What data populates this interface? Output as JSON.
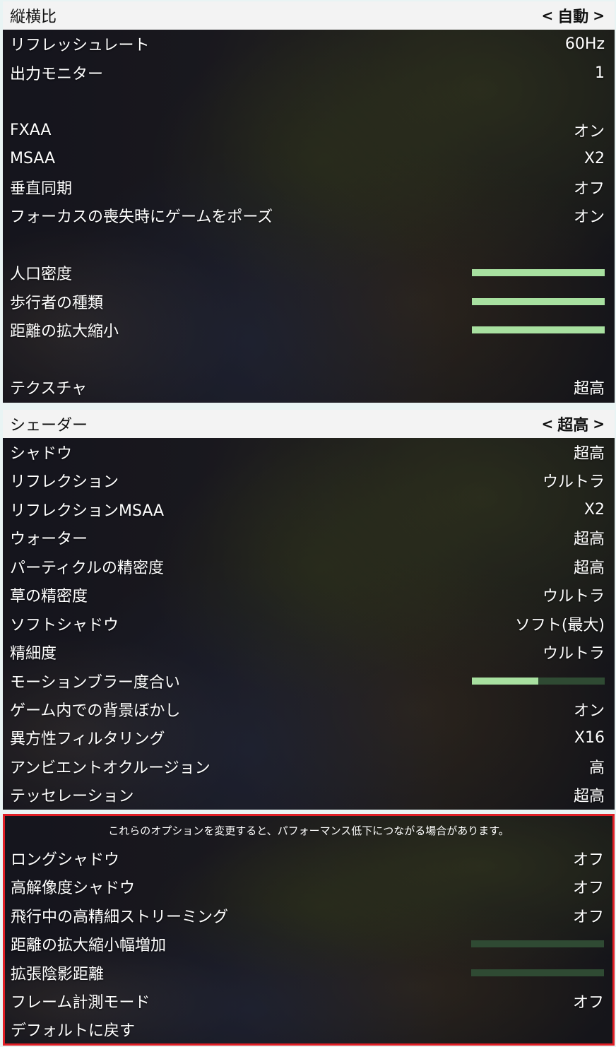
{
  "display_section": {
    "selected_row": {
      "label": "縦横比",
      "value": "自動",
      "left_arrow": "<",
      "right_arrow": ">"
    },
    "rows": [
      {
        "label": "リフレッシュレート",
        "value": "60Hz"
      },
      {
        "label": "出力モニター",
        "value": "1"
      },
      {
        "label": "FXAA",
        "value": "オン"
      },
      {
        "label": "MSAA",
        "value": "X2"
      },
      {
        "label": "垂直同期",
        "value": "オフ"
      },
      {
        "label": "フォーカスの喪失時にゲームをポーズ",
        "value": "オン"
      },
      {
        "label": "人口密度",
        "level": 1.0
      },
      {
        "label": "歩行者の種類",
        "level": 1.0
      },
      {
        "label": "距離の拡大縮小",
        "level": 1.0
      },
      {
        "label": "テクスチャ",
        "value": "超高"
      }
    ]
  },
  "graphics_section": {
    "selected_row": {
      "label": "シェーダー",
      "value": "超高",
      "left_arrow": "<",
      "right_arrow": ">"
    },
    "rows": [
      {
        "label": "シャドウ",
        "value": "超高"
      },
      {
        "label": "リフレクション",
        "value": "ウルトラ"
      },
      {
        "label": "リフレクションMSAA",
        "value": "X2"
      },
      {
        "label": "ウォーター",
        "value": "超高"
      },
      {
        "label": "パーティクルの精密度",
        "value": "超高"
      },
      {
        "label": "草の精密度",
        "value": "ウルトラ"
      },
      {
        "label": "ソフトシャドウ",
        "value": "ソフト(最大)"
      },
      {
        "label": "精細度",
        "value": "ウルトラ"
      },
      {
        "label": "モーションブラー度合い",
        "level": 0.5
      },
      {
        "label": "ゲーム内での背景ぼかし",
        "value": "オン"
      },
      {
        "label": "異方性フィルタリング",
        "value": "X16"
      },
      {
        "label": "アンビエントオクルージョン",
        "value": "高"
      },
      {
        "label": "テッセレーション",
        "value": "超高"
      }
    ]
  },
  "advanced_section": {
    "notice": "これらのオプションを変更すると、パフォーマンス低下につながる場合があります。",
    "rows": [
      {
        "label": "ロングシャドウ",
        "value": "オフ"
      },
      {
        "label": "高解像度シャドウ",
        "value": "オフ"
      },
      {
        "label": "飛行中の高精細ストリーミング",
        "value": "オフ"
      },
      {
        "label": "距離の拡大縮小幅増加",
        "level": 0.0
      },
      {
        "label": "拡張陰影距離",
        "level": 0.0
      },
      {
        "label": "フレーム計測モード",
        "value": "オフ"
      },
      {
        "label": "デフォルトに戻す"
      }
    ]
  },
  "colors": {
    "slider_fill": "#a8e0a0",
    "slider_track": "#2f4a33",
    "highlight_row": "#f3f3f3",
    "warning_border": "#e01f26"
  }
}
